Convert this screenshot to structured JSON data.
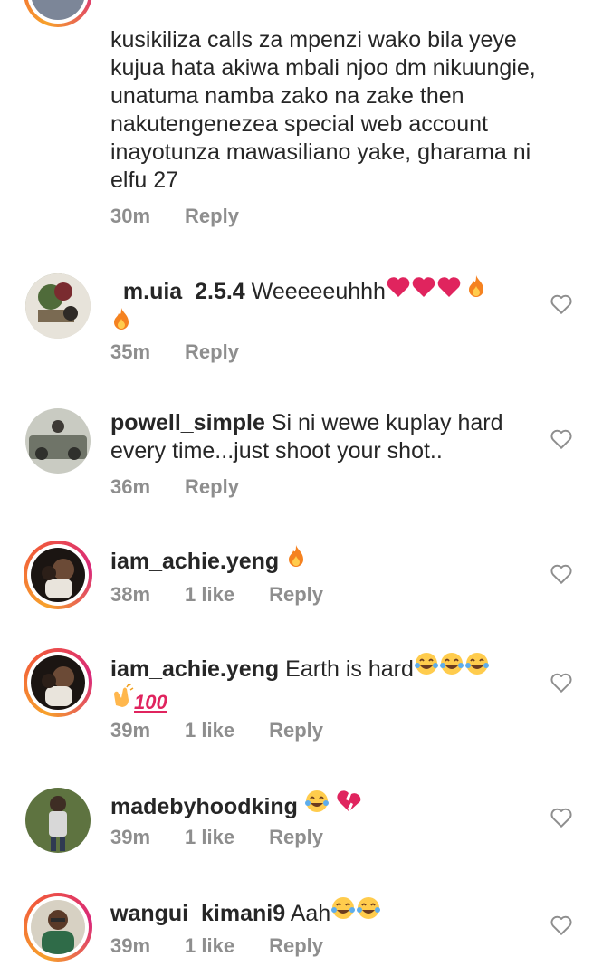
{
  "comments": [
    {
      "username": "",
      "text": "kusikiliza calls za mpenzi wako bila yeye kujua hata akiwa mbali njoo dm nikuungie, unatuma namba zako na zake then nakutengenezea special web account inayotunza mawasiliano yake, gharama ni elfu 27",
      "time": "30m",
      "likes": "",
      "reply": "Reply"
    },
    {
      "username": "_m.uia_2.5.4",
      "text": "Weeeeeuhhh",
      "emojis": "❤❤❤🔥🔥",
      "time": "35m",
      "likes": "",
      "reply": "Reply"
    },
    {
      "username": "powell_simple",
      "text": "Si ni wewe kuplay hard every time...just shoot your shot..",
      "time": "36m",
      "likes": "",
      "reply": "Reply"
    },
    {
      "username": "iam_achie.yeng",
      "text": "",
      "emojis": "🔥",
      "time": "38m",
      "likes": "1 like",
      "reply": "Reply"
    },
    {
      "username": "iam_achie.yeng",
      "text": "Earth is hard",
      "emojis": "😂😂😂👏💯",
      "time": "39m",
      "likes": "1 like",
      "reply": "Reply"
    },
    {
      "username": "madebyhoodking",
      "text": "",
      "emojis": "😂 💔",
      "time": "39m",
      "likes": "1 like",
      "reply": "Reply"
    },
    {
      "username": "wangui_kimani9",
      "text": "Aah",
      "emojis": "😂😂",
      "time": "39m",
      "likes": "1 like",
      "reply": "Reply"
    }
  ],
  "colors": {
    "text": "#262626",
    "meta": "#8e8e8e",
    "heart_outline": "#8e8e8e",
    "red_heart": "#e0245e",
    "fire": "#f58220",
    "story_ring_start": "#f7a12b",
    "story_ring_end": "#d9287a"
  },
  "icons": {
    "like": "heart-outline-icon",
    "red_heart": "red-heart-emoji",
    "fire": "fire-emoji",
    "laugh": "tears-of-joy-emoji",
    "broken_heart": "broken-heart-emoji",
    "clap": "clapping-hands-emoji",
    "hundred": "hundred-points-emoji"
  }
}
